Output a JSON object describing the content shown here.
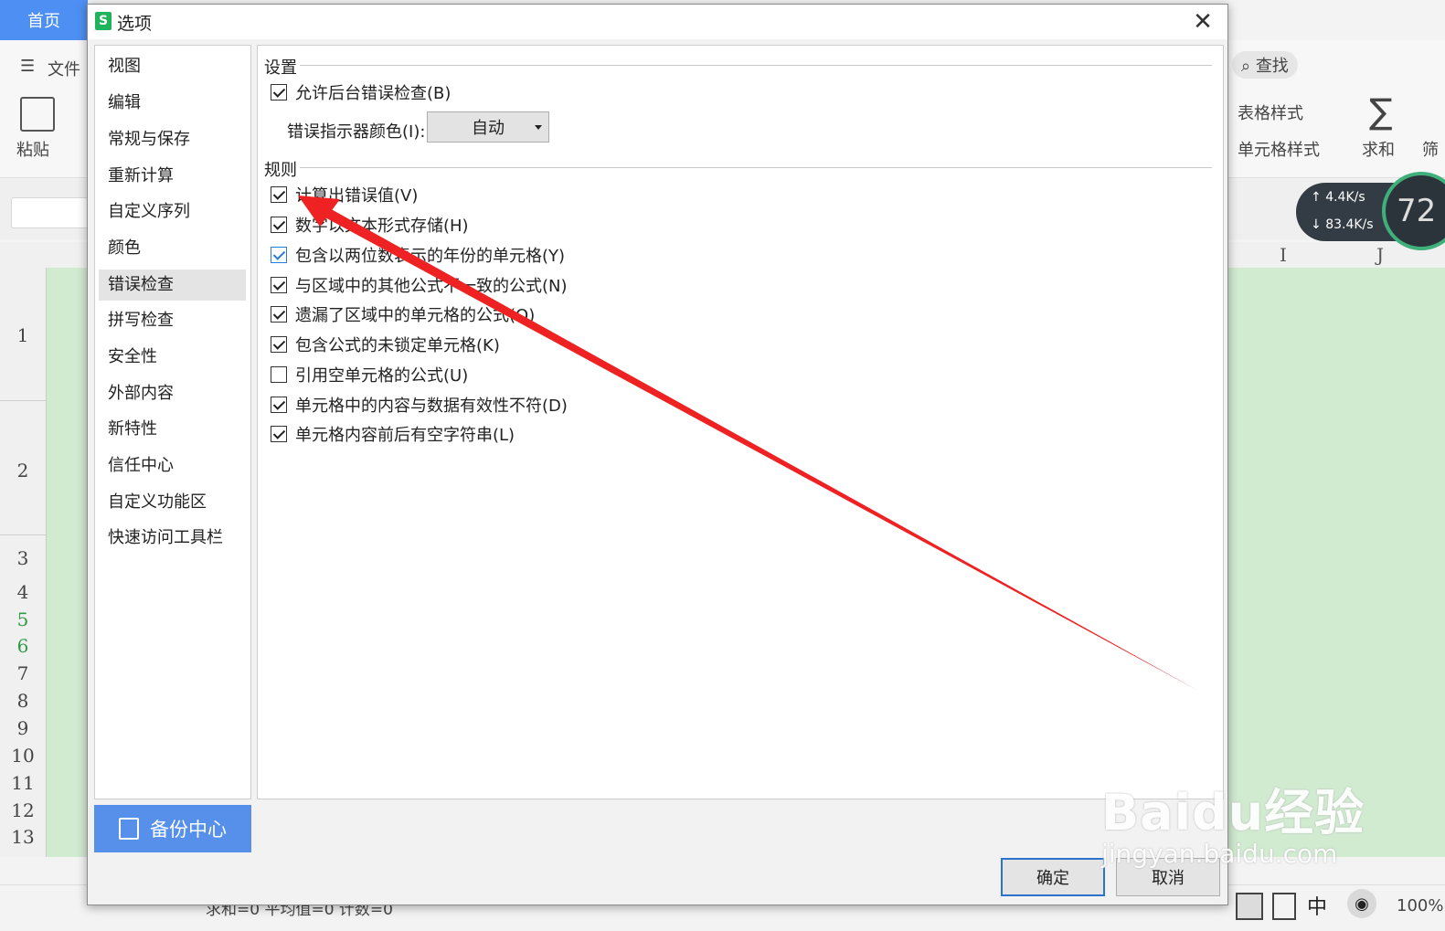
{
  "background_app": {
    "home_tab": "首页",
    "file_menu": "文件",
    "paste_label": "粘贴",
    "search_label": "查找",
    "table_style": "表格样式",
    "cell_style": "单元格样式",
    "sum_label": "求和",
    "filter_label": "筛",
    "col_i": "I",
    "col_j": "J",
    "row_numbers": [
      "1",
      "2",
      "3",
      "4",
      "5",
      "6",
      "7",
      "8",
      "9",
      "10",
      "11",
      "12",
      "13"
    ],
    "status_text": "求和=0  平均值=0  计数=0",
    "zoom": "100%",
    "net_up": "4.4K/s",
    "net_down": "83.4K/s",
    "net_percent": "72"
  },
  "dialog": {
    "title": "选项",
    "nav_items": [
      "视图",
      "编辑",
      "常规与保存",
      "重新计算",
      "自定义序列",
      "颜色",
      "错误检查",
      "拼写检查",
      "安全性",
      "外部内容",
      "新特性",
      "信任中心",
      "自定义功能区",
      "快速访问工具栏"
    ],
    "selected_nav": "错误检查",
    "backup_label": "备份中心",
    "settings": {
      "heading": "设置",
      "allow_background": {
        "label": "允许后台错误检查(B)",
        "checked": true
      },
      "indicator_color_label": "错误指示器颜色(I):",
      "indicator_color_value": "自动"
    },
    "rules": {
      "heading": "规则",
      "items": [
        {
          "label": "计算出错误值(V)",
          "checked": true
        },
        {
          "label": "数字以文本形式存储(H)",
          "checked": true
        },
        {
          "label": "包含以两位数表示的年份的单元格(Y)",
          "checked": true
        },
        {
          "label": "与区域中的其他公式不一致的公式(N)",
          "checked": true
        },
        {
          "label": "遗漏了区域中的单元格的公式(O)",
          "checked": true
        },
        {
          "label": "包含公式的未锁定单元格(K)",
          "checked": true
        },
        {
          "label": "引用空单元格的公式(U)",
          "checked": false
        },
        {
          "label": "单元格中的内容与数据有效性不符(D)",
          "checked": true
        },
        {
          "label": "单元格内容前后有空字符串(L)",
          "checked": true
        }
      ]
    },
    "ok_label": "确定",
    "cancel_label": "取消"
  },
  "watermark": {
    "brand": "Baidu经验",
    "url": "jingyan.baidu.com"
  },
  "colors": {
    "accent": "#4d8ff2",
    "backup_button": "#5690ea",
    "arrow": "#ee2222",
    "sheet_green": "#d1ebd1"
  }
}
